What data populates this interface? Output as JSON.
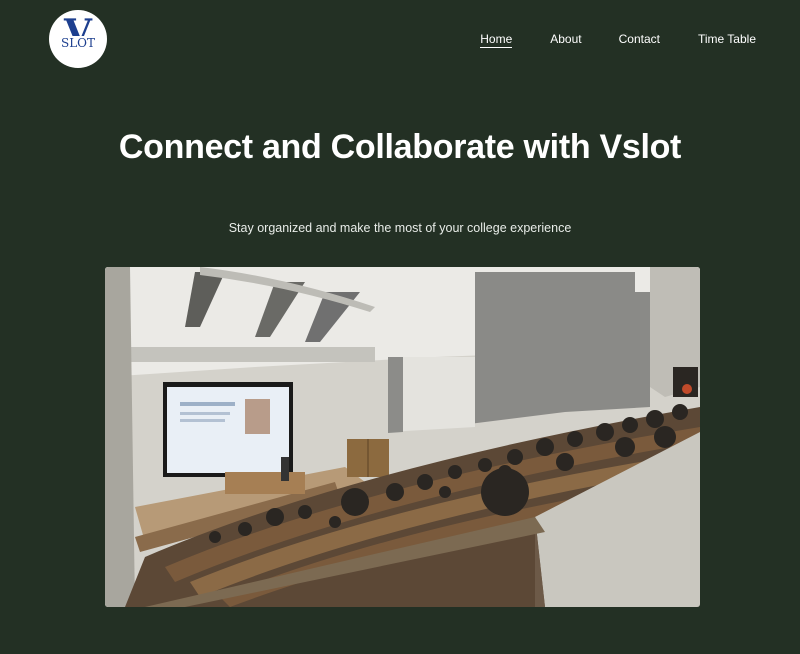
{
  "logo": {
    "letter": "V",
    "text": "SLOT"
  },
  "nav": {
    "items": [
      {
        "label": "Home",
        "active": true
      },
      {
        "label": "About",
        "active": false
      },
      {
        "label": "Contact",
        "active": false
      },
      {
        "label": "Time Table",
        "active": false
      }
    ]
  },
  "hero": {
    "title": "Connect and Collaborate with Vslot",
    "subtitle": "Stay organized and make the most of your college experience"
  },
  "colors": {
    "background": "#233024",
    "text": "#ffffff",
    "logo_blue": "#1d3f8f"
  }
}
